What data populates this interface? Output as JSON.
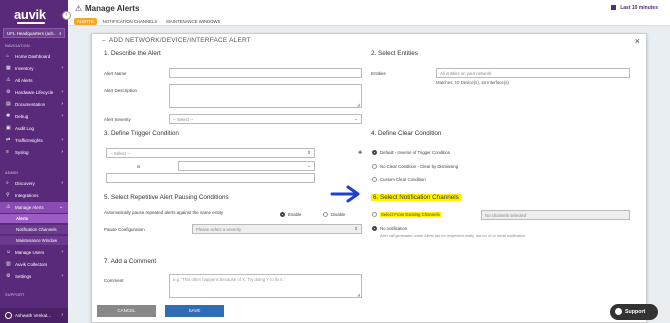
{
  "sidebar": {
    "logo": "auvik",
    "site": "UFL Headquarters (adr...",
    "sections": {
      "navigation": "NAVIGATION",
      "admin": "ADMIN",
      "support": "SUPPORT"
    },
    "nav": [
      {
        "label": "Home Dashboard",
        "icon": "home-icon"
      },
      {
        "label": "Inventory",
        "icon": "inventory-icon",
        "arrow": true
      },
      {
        "label": "All Alerts",
        "icon": "alert-icon"
      },
      {
        "label": "Hardware Lifecycle",
        "icon": "hardware-icon",
        "arrow": true
      },
      {
        "label": "Documentation",
        "icon": "doc-icon",
        "arrow": true
      },
      {
        "label": "Debug",
        "icon": "debug-icon",
        "arrow": true
      },
      {
        "label": "Audit Log",
        "icon": "audit-icon"
      },
      {
        "label": "TrafficInsights",
        "icon": "traffic-icon",
        "arrow": true
      },
      {
        "label": "Syslog",
        "icon": "syslog-icon",
        "arrow": true
      }
    ],
    "admin_nav": [
      {
        "label": "Discovery",
        "icon": "discovery-icon",
        "arrow": true
      },
      {
        "label": "Integrations",
        "icon": "integrations-icon"
      },
      {
        "label": "Manage Alerts",
        "icon": "manage-alerts-icon",
        "arrow": true
      }
    ],
    "alerts_sub": [
      "Alerts",
      "Notification Channels",
      "Maintenance Window"
    ],
    "admin_nav2": [
      {
        "label": "Manage Users",
        "icon": "users-icon",
        "arrow": true
      },
      {
        "label": "Auvik Collectors",
        "icon": "collectors-icon"
      },
      {
        "label": "Settings",
        "icon": "settings-icon",
        "arrow": true
      }
    ],
    "user": "Ashwath Venkat..."
  },
  "header": {
    "title": "Manage Alerts",
    "tabs": [
      "ALERTS",
      "NOTIFICATION CHANNELS",
      "MAINTENANCE WINDOWS"
    ],
    "time_range": "Last 10 minutes"
  },
  "modal": {
    "title": "ADD NETWORK/DEVICE/INTERFACE ALERT",
    "s1": "1. Describe the Alert",
    "alert_name_label": "Alert Name",
    "alert_desc_label": "Alert Description",
    "severity_label": "Alert Severity",
    "severity_value": "-- Select --",
    "s2": "2. Select Entities",
    "entities_label": "Entities",
    "entities_placeholder": "All entities on your network",
    "matches": "Matches: 10 Device(s), 18 Interface(s)",
    "s3": "3. Define Trigger Condition",
    "trigger_select": "-- Select --",
    "is_label": "is",
    "s4": "4. Define Clear Condition",
    "clear_options": [
      "Default - Inverse of Trigger Condition",
      "No Clear Condition - Clear by Dismissing",
      "Custom Clear Condition"
    ],
    "s5": "5. Select Repetitive Alert Pausing Conditions",
    "auto_pause_label": "Automatically pause repeated alerts against the same entity",
    "enable": "Enable",
    "disable": "Disable",
    "pause_config_label": "Pause Configuration",
    "pause_config_placeholder": "Please select a severity",
    "s6": "6. Select Notification Channels",
    "select_existing": "Select From Existing Channels",
    "no_channels": "No channels selected",
    "no_notification": "No notification",
    "no_notification_hint": "Alert still generated under Alerts tab for respective entity, but no UI or email notification",
    "s7": "7. Add a Comment",
    "comment_label": "Comment",
    "comment_placeholder": "e.g. 'This often happens because of X. Try doing Y to fix it.'",
    "cancel": "CANCEL",
    "save": "SAVE"
  },
  "support": "Support",
  "colors": {
    "sidebar": "#5a2a7a",
    "accent": "#f5a623",
    "save": "#2e6db4",
    "highlight": "#fff200",
    "arrow": "#1f3fd1"
  }
}
